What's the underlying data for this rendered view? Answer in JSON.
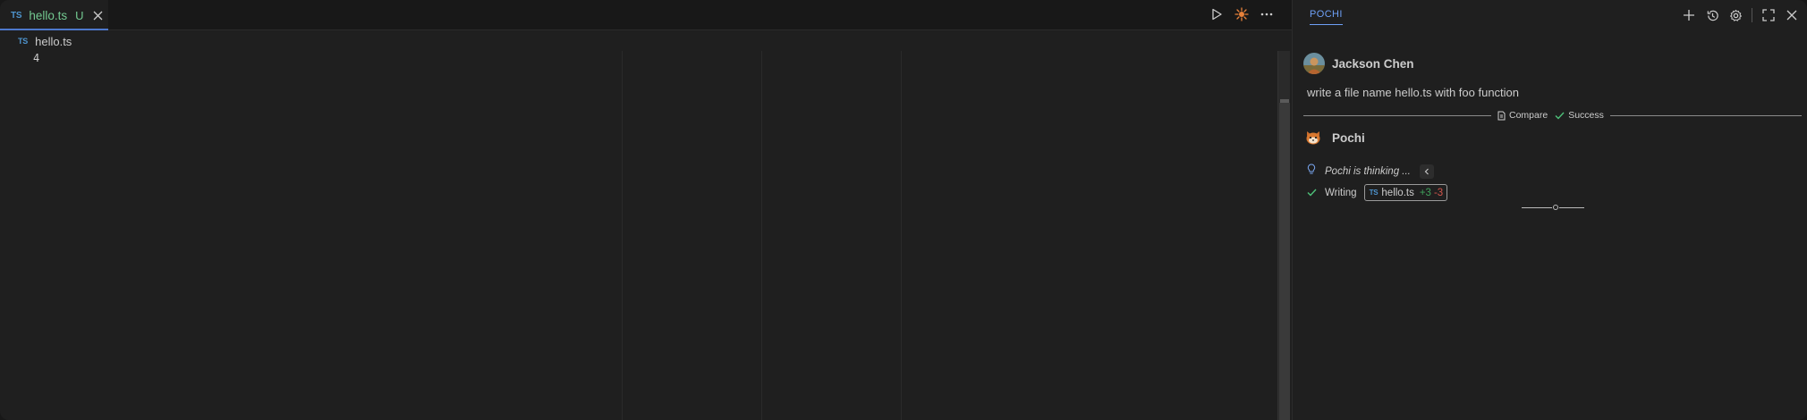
{
  "editor": {
    "tab": {
      "language_badge": "TS",
      "label": "hello.ts",
      "status": "U"
    },
    "breadcrumb": {
      "language_badge": "TS",
      "label": "hello.ts"
    },
    "line_number": "4",
    "toolbar": {
      "icons": [
        "run-icon",
        "pochi-burst-icon",
        "more-icon"
      ]
    }
  },
  "panel": {
    "title": "POCHI",
    "actions": [
      "new-task-icon",
      "history-icon",
      "settings-icon",
      "maximize-icon",
      "close-icon"
    ],
    "user_message": {
      "author": "Jackson Chen",
      "text": "write a file name hello.ts with foo function"
    },
    "checkpoint": {
      "compare_label": "Compare",
      "status_label": "Success"
    },
    "assistant": {
      "name": "Pochi",
      "thinking_text": "Pochi is thinking ...",
      "tool": {
        "action_label": "Writing",
        "file_badge": "TS",
        "file_name": "hello.ts",
        "added": "+3",
        "removed": "-3"
      }
    }
  },
  "colors": {
    "accent": "#6ea0f7",
    "tab_modified": "#73c991",
    "added": "#3fa05a",
    "removed": "#d2554b",
    "success": "#4ec27a"
  }
}
